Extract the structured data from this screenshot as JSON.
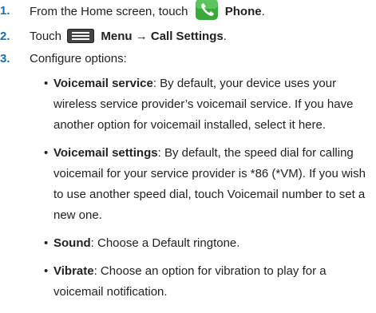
{
  "steps": [
    {
      "num": "1.",
      "before": "From the Home screen, touch",
      "icon": "phone-icon",
      "label": "Phone",
      "after": "."
    },
    {
      "num": "2.",
      "before": "Touch",
      "icon": "menu-icon",
      "label": "Menu → Call Settings",
      "after": "."
    },
    {
      "num": "3.",
      "text": "Configure options:"
    }
  ],
  "options": [
    {
      "term": "Voicemail service",
      "desc": ": By default, your device uses your wireless service provider’s voicemail service. If you have another option for voicemail installed, select it here."
    },
    {
      "term": "Voicemail settings",
      "desc": ": By default, the speed dial for calling voicemail for your service provider is *86 (*VM). If you wish to use another speed dial, touch Voicemail number to set a new one."
    },
    {
      "term": "Sound",
      "desc": ": Choose a Default ringtone."
    },
    {
      "term": "Vibrate",
      "desc": ": Choose an option for vibration to play for a voicemail notification."
    }
  ],
  "colors": {
    "step_number": "#1a6fae",
    "phone_icon_bg": "#3aa93a",
    "menu_icon_bg": "#444444"
  }
}
